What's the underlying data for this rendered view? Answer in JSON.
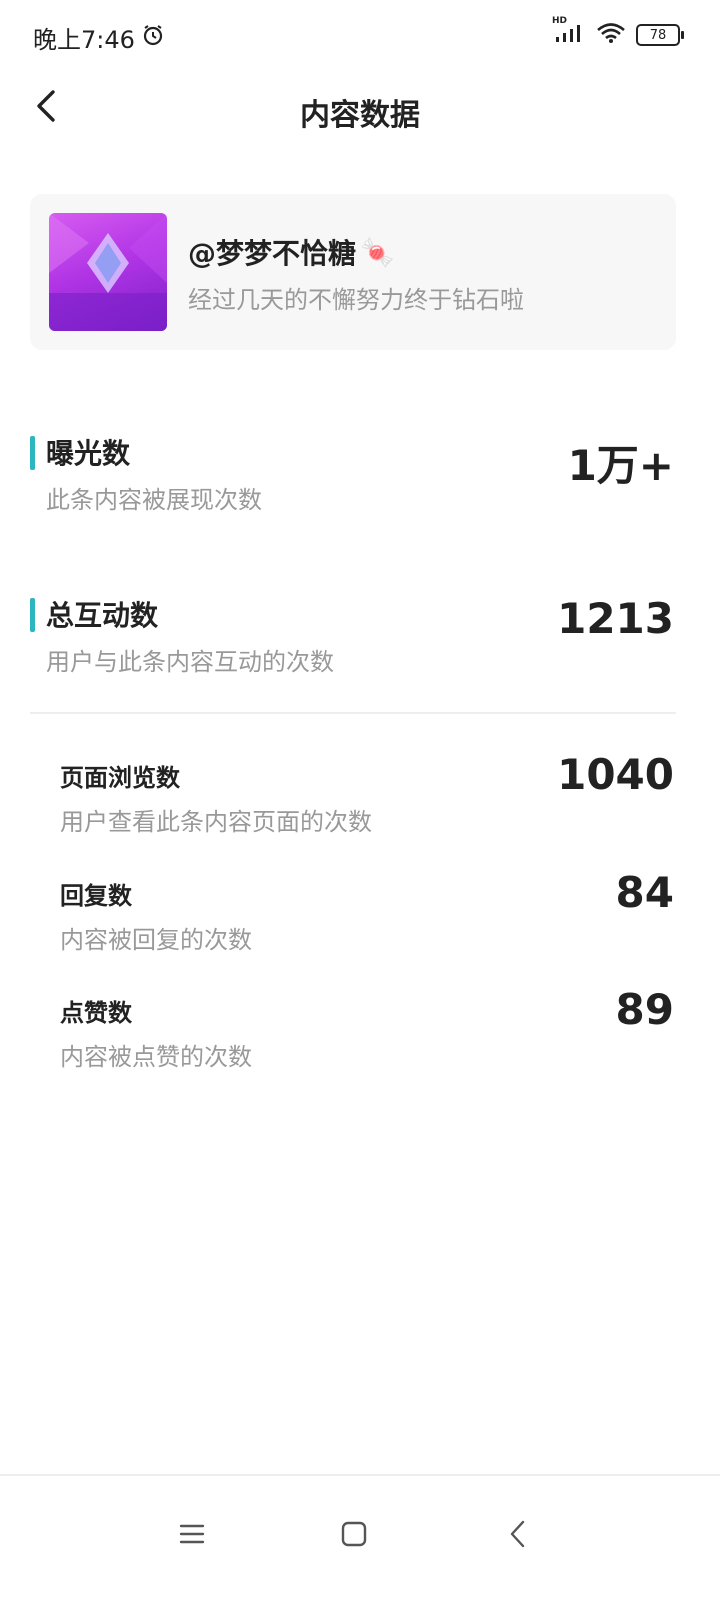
{
  "status_bar": {
    "time": "晚上7:46",
    "network": "HD",
    "battery": "78",
    "icons": [
      "alarm-icon",
      "signal-icon",
      "wifi-icon",
      "battery-icon"
    ]
  },
  "header": {
    "title": "内容数据",
    "back_icon": "chevron-left-icon"
  },
  "post": {
    "author": "@梦梦不恰糖",
    "author_emoji": "🍬",
    "description": "经过几天的不懈努力终于钻石啦"
  },
  "metrics": [
    {
      "label": "曝光数",
      "sub": "此条内容被展现次数",
      "value": "1万+"
    },
    {
      "label": "总互动数",
      "sub": "用户与此条内容互动的次数",
      "value": "1213"
    }
  ],
  "sub_metrics": [
    {
      "label": "页面浏览数",
      "sub": "用户查看此条内容页面的次数",
      "value": "1040"
    },
    {
      "label": "回复数",
      "sub": "内容被回复的次数",
      "value": "84"
    },
    {
      "label": "点赞数",
      "sub": "内容被点赞的次数",
      "value": "89"
    }
  ],
  "nav_bar": {
    "icons": [
      "menu-icon",
      "home-icon",
      "back-icon"
    ]
  },
  "colors": {
    "accent": "#2bb6c0",
    "text": "#222222",
    "subtext": "#999999"
  }
}
